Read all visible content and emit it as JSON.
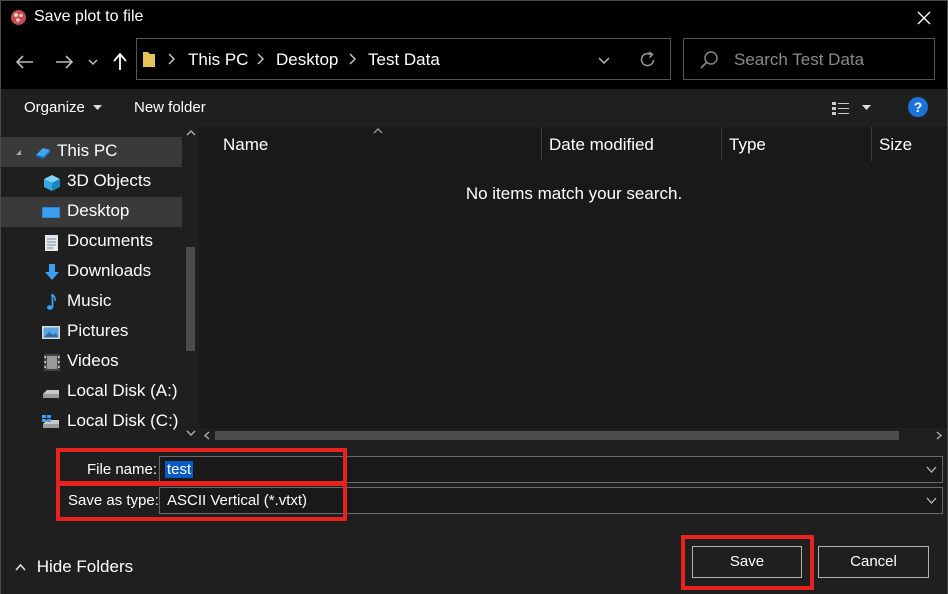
{
  "window": {
    "title": "Save plot to file"
  },
  "nav": {
    "breadcrumbs": [
      "This PC",
      "Desktop",
      "Test Data"
    ],
    "search_placeholder": "Search Test Data"
  },
  "commands": {
    "organize": "Organize",
    "new_folder": "New folder",
    "help": "?"
  },
  "tree": [
    {
      "label": "This PC",
      "icon": "computer-icon"
    },
    {
      "label": "3D Objects",
      "icon": "cube-icon"
    },
    {
      "label": "Desktop",
      "icon": "desktop-icon",
      "selected": true
    },
    {
      "label": "Documents",
      "icon": "document-icon"
    },
    {
      "label": "Downloads",
      "icon": "download-icon"
    },
    {
      "label": "Music",
      "icon": "music-note-icon"
    },
    {
      "label": "Pictures",
      "icon": "picture-icon"
    },
    {
      "label": "Videos",
      "icon": "film-icon"
    },
    {
      "label": "Local Disk (A:)",
      "icon": "drive-icon"
    },
    {
      "label": "Local Disk (C:)",
      "icon": "windows-drive-icon"
    }
  ],
  "columns": [
    "Name",
    "Date modified",
    "Type",
    "Size"
  ],
  "empty_message": "No items match your search.",
  "form": {
    "file_name_label": "File name:",
    "file_name_value": "test",
    "save_type_label": "Save as type:",
    "save_type_value": "ASCII Vertical (*.vtxt)"
  },
  "buttons": {
    "hide_folders": "Hide Folders",
    "save": "Save",
    "cancel": "Cancel"
  },
  "colors": {
    "highlight": "#e8221e",
    "accent": "#1a73d9",
    "selection": "#0a5bc4"
  }
}
